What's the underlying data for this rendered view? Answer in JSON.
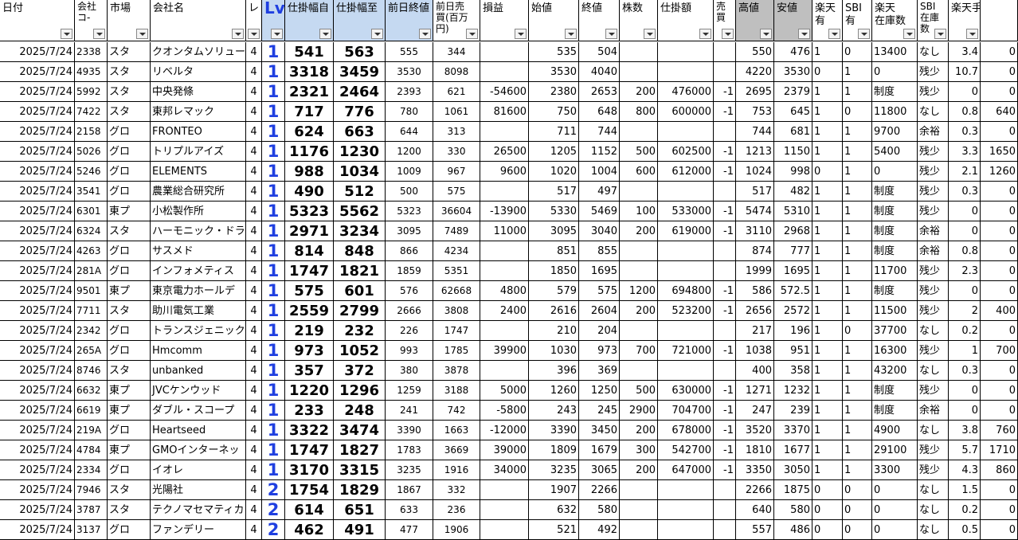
{
  "headers": [
    {
      "key": "date",
      "label": "日付"
    },
    {
      "key": "code",
      "label": "会社\nコ-"
    },
    {
      "key": "market",
      "label": "市場"
    },
    {
      "key": "name",
      "label": "会社名"
    },
    {
      "key": "lev",
      "label": "レ"
    },
    {
      "key": "lv",
      "label": "Lv"
    },
    {
      "key": "from",
      "label": "仕掛幅自"
    },
    {
      "key": "to",
      "label": "仕掛幅至"
    },
    {
      "key": "prev_close",
      "label": "前日終値"
    },
    {
      "key": "prev_vol",
      "label": "前日売\n買(百万\n円)"
    },
    {
      "key": "pl",
      "label": "損益"
    },
    {
      "key": "open",
      "label": "始値"
    },
    {
      "key": "close",
      "label": "終値"
    },
    {
      "key": "shares",
      "label": "株数"
    },
    {
      "key": "amount",
      "label": "仕掛額"
    },
    {
      "key": "sell",
      "label": "売\n買"
    },
    {
      "key": "high",
      "label": "高値"
    },
    {
      "key": "low",
      "label": "安値"
    },
    {
      "key": "rakuten",
      "label": "楽天\n有"
    },
    {
      "key": "sbi",
      "label": "SBI\n有"
    },
    {
      "key": "stock",
      "label": "楽天\n在庫数"
    },
    {
      "key": "sbi_stock",
      "label": "SBI\n在庫\n数"
    },
    {
      "key": "fee",
      "label": "楽天手数料"
    },
    {
      "key": "extra",
      "label": ""
    }
  ],
  "rows": [
    [
      "2025/7/24",
      "2338",
      "スタ",
      "クオンタムソリュー",
      "4",
      "1",
      "541",
      "563",
      "555",
      "344",
      "",
      "535",
      "504",
      "",
      "",
      "",
      "550",
      "476",
      "1",
      "0",
      "13400",
      "なし",
      "3.4",
      "0"
    ],
    [
      "2025/7/24",
      "4935",
      "スタ",
      "リベルタ",
      "4",
      "1",
      "3318",
      "3459",
      "3530",
      "8098",
      "",
      "3530",
      "4040",
      "",
      "",
      "",
      "4220",
      "3530",
      "0",
      "1",
      "0",
      "残少",
      "10.7",
      "0"
    ],
    [
      "2025/7/24",
      "5992",
      "スタ",
      "中央発條",
      "4",
      "1",
      "2321",
      "2464",
      "2393",
      "621",
      "-54600",
      "2380",
      "2653",
      "200",
      "476000",
      "-1",
      "2695",
      "2379",
      "1",
      "1",
      "制度",
      "残少",
      "0",
      "0"
    ],
    [
      "2025/7/24",
      "7422",
      "スタ",
      "東邦レマック",
      "4",
      "1",
      "717",
      "776",
      "780",
      "1061",
      "81600",
      "750",
      "648",
      "800",
      "600000",
      "-1",
      "753",
      "645",
      "1",
      "0",
      "11800",
      "なし",
      "0.8",
      "640"
    ],
    [
      "2025/7/24",
      "2158",
      "グロ",
      "FRONTEO",
      "4",
      "1",
      "624",
      "663",
      "644",
      "313",
      "",
      "711",
      "744",
      "",
      "",
      "",
      "744",
      "681",
      "1",
      "1",
      "9700",
      "余裕",
      "0.3",
      "0"
    ],
    [
      "2025/7/24",
      "5026",
      "グロ",
      "トリプルアイズ",
      "4",
      "1",
      "1176",
      "1230",
      "1200",
      "330",
      "26500",
      "1205",
      "1152",
      "500",
      "602500",
      "-1",
      "1213",
      "1150",
      "1",
      "1",
      "5400",
      "残少",
      "3.3",
      "1650"
    ],
    [
      "2025/7/24",
      "5246",
      "グロ",
      "ELEMENTS",
      "4",
      "1",
      "988",
      "1034",
      "1009",
      "967",
      "9600",
      "1020",
      "1004",
      "600",
      "612000",
      "-1",
      "1024",
      "998",
      "0",
      "1",
      "0",
      "残少",
      "2.1",
      "1260"
    ],
    [
      "2025/7/24",
      "3541",
      "グロ",
      "農業総合研究所",
      "4",
      "1",
      "490",
      "512",
      "500",
      "575",
      "",
      "517",
      "497",
      "",
      "",
      "",
      "517",
      "482",
      "1",
      "1",
      "制度",
      "残少",
      "0.3",
      "0"
    ],
    [
      "2025/7/24",
      "6301",
      "東プ",
      "小松製作所",
      "4",
      "1",
      "5323",
      "5562",
      "5323",
      "36604",
      "-13900",
      "5330",
      "5469",
      "100",
      "533000",
      "-1",
      "5474",
      "5310",
      "1",
      "1",
      "制度",
      "残少",
      "0",
      "0"
    ],
    [
      "2025/7/24",
      "6324",
      "スタ",
      "ハーモニック・ドライ",
      "4",
      "1",
      "2971",
      "3234",
      "3095",
      "7489",
      "11000",
      "3095",
      "3040",
      "200",
      "619000",
      "-1",
      "3110",
      "2968",
      "1",
      "1",
      "制度",
      "余裕",
      "0",
      "0"
    ],
    [
      "2025/7/24",
      "4263",
      "グロ",
      "サスメド",
      "4",
      "1",
      "814",
      "848",
      "866",
      "4234",
      "",
      "851",
      "855",
      "",
      "",
      "",
      "874",
      "777",
      "1",
      "1",
      "制度",
      "余裕",
      "0.8",
      "0"
    ],
    [
      "2025/7/24",
      "281A",
      "グロ",
      "インフォメティス",
      "4",
      "1",
      "1747",
      "1821",
      "1859",
      "5351",
      "",
      "1850",
      "1695",
      "",
      "",
      "",
      "1999",
      "1695",
      "1",
      "1",
      "11700",
      "残少",
      "2.3",
      "0"
    ],
    [
      "2025/7/24",
      "9501",
      "東プ",
      "東京電力ホールデ",
      "4",
      "1",
      "575",
      "601",
      "576",
      "62668",
      "4800",
      "579",
      "575",
      "1200",
      "694800",
      "-1",
      "586",
      "572.5",
      "1",
      "1",
      "制度",
      "残少",
      "0",
      "0"
    ],
    [
      "2025/7/24",
      "7711",
      "スタ",
      "助川電気工業",
      "4",
      "1",
      "2559",
      "2799",
      "2666",
      "3808",
      "2400",
      "2616",
      "2604",
      "200",
      "523200",
      "-1",
      "2656",
      "2572",
      "1",
      "1",
      "11500",
      "残少",
      "2",
      "400"
    ],
    [
      "2025/7/24",
      "2342",
      "グロ",
      "トランスジェニックグ",
      "4",
      "1",
      "219",
      "232",
      "226",
      "1747",
      "",
      "210",
      "204",
      "",
      "",
      "",
      "217",
      "196",
      "1",
      "0",
      "37700",
      "なし",
      "0.2",
      "0"
    ],
    [
      "2025/7/24",
      "265A",
      "グロ",
      "Hmcomm",
      "4",
      "1",
      "973",
      "1052",
      "993",
      "1785",
      "39900",
      "1030",
      "973",
      "700",
      "721000",
      "-1",
      "1038",
      "951",
      "1",
      "1",
      "16300",
      "残少",
      "1",
      "700"
    ],
    [
      "2025/7/24",
      "8746",
      "スタ",
      "unbanked",
      "4",
      "1",
      "357",
      "372",
      "380",
      "3878",
      "",
      "396",
      "369",
      "",
      "",
      "",
      "400",
      "358",
      "1",
      "1",
      "43200",
      "なし",
      "0.3",
      "0"
    ],
    [
      "2025/7/24",
      "6632",
      "東プ",
      "JVCケンウッド",
      "4",
      "1",
      "1220",
      "1296",
      "1259",
      "3188",
      "5000",
      "1260",
      "1250",
      "500",
      "630000",
      "-1",
      "1271",
      "1232",
      "1",
      "1",
      "制度",
      "残少",
      "0",
      "0"
    ],
    [
      "2025/7/24",
      "6619",
      "東プ",
      "ダブル・スコープ",
      "4",
      "1",
      "233",
      "248",
      "241",
      "742",
      "-5800",
      "243",
      "245",
      "2900",
      "704700",
      "-1",
      "247",
      "239",
      "1",
      "1",
      "制度",
      "余裕",
      "0",
      "0"
    ],
    [
      "2025/7/24",
      "219A",
      "グロ",
      "Heartseed",
      "4",
      "1",
      "3322",
      "3474",
      "3390",
      "1663",
      "-12000",
      "3390",
      "3450",
      "200",
      "678000",
      "-1",
      "3520",
      "3370",
      "1",
      "1",
      "4900",
      "なし",
      "3.8",
      "760"
    ],
    [
      "2025/7/24",
      "4784",
      "東プ",
      "GMOインターネッ",
      "4",
      "1",
      "1747",
      "1827",
      "1783",
      "3669",
      "39000",
      "1809",
      "1679",
      "300",
      "542700",
      "-1",
      "1810",
      "1677",
      "1",
      "1",
      "29100",
      "残少",
      "5.7",
      "1710"
    ],
    [
      "2025/7/24",
      "2334",
      "グロ",
      "イオレ",
      "4",
      "1",
      "3170",
      "3315",
      "3235",
      "1916",
      "34000",
      "3235",
      "3065",
      "200",
      "647000",
      "-1",
      "3350",
      "3050",
      "1",
      "1",
      "3300",
      "残少",
      "4.3",
      "860"
    ],
    [
      "2025/7/24",
      "7946",
      "スタ",
      "光陽社",
      "4",
      "2",
      "1754",
      "1829",
      "1867",
      "332",
      "",
      "1907",
      "2266",
      "",
      "",
      "",
      "2266",
      "1875",
      "0",
      "0",
      "0",
      "なし",
      "1.5",
      "0"
    ],
    [
      "2025/7/24",
      "3787",
      "スタ",
      "テクノマセマティカ",
      "4",
      "2",
      "614",
      "651",
      "633",
      "236",
      "",
      "632",
      "580",
      "",
      "",
      "",
      "640",
      "580",
      "0",
      "0",
      "0",
      "なし",
      "0.2",
      "0"
    ],
    [
      "2025/7/24",
      "3137",
      "グロ",
      "ファンデリー",
      "4",
      "2",
      "462",
      "491",
      "477",
      "1906",
      "",
      "521",
      "492",
      "",
      "",
      "",
      "557",
      "486",
      "0",
      "0",
      "0",
      "なし",
      "0.5",
      "0"
    ]
  ]
}
